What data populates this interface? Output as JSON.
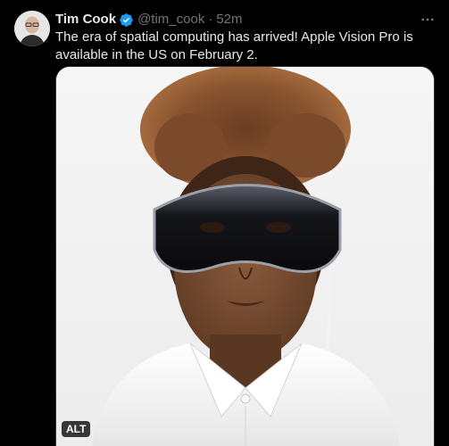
{
  "tweet": {
    "display_name": "Tim Cook",
    "handle": "@tim_cook",
    "separator": "·",
    "time": "52m",
    "text": "The era of spatial computing has arrived! Apple Vision Pro is available in the US on February 2.",
    "media": {
      "alt_badge": "ALT"
    }
  },
  "colors": {
    "background": "#000000",
    "text_primary": "#e7e9ea",
    "text_secondary": "#71767b",
    "verified_badge": "#1d9bf0"
  },
  "icons": {
    "verified": "verified-badge-icon",
    "more": "more-horizontal-icon"
  }
}
